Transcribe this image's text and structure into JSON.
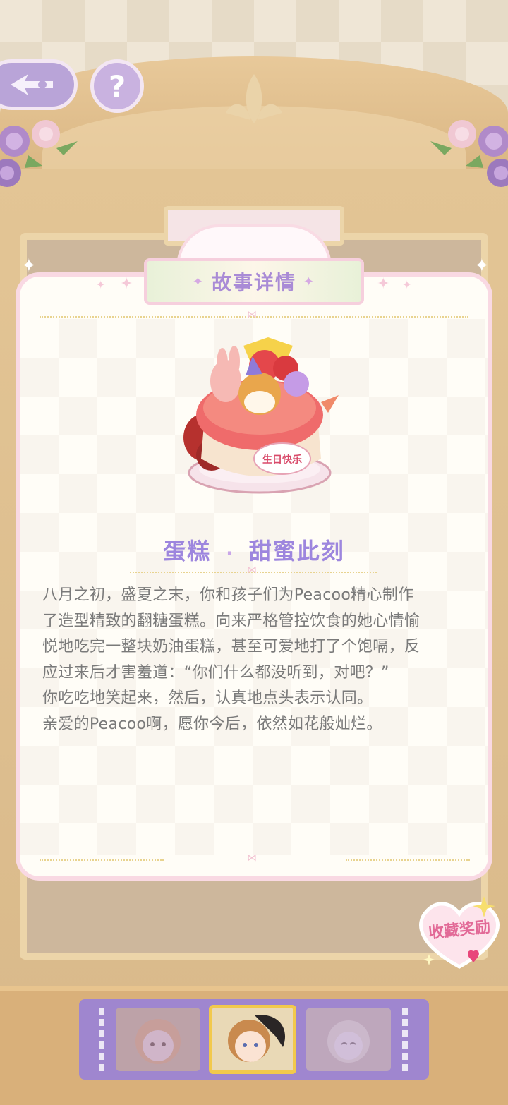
{
  "header": {
    "back_icon": "back-arrow-icon",
    "help_label": "?"
  },
  "dialog": {
    "title": "故事详情",
    "item_name_part1": "蛋糕",
    "item_name_part2": "甜蜜此刻",
    "item_image": "birthday-cake-image",
    "cake_plaque_text": "生日快乐",
    "story_lines": [
      "八月之初，盛夏之末，你和孩子们为Peacoo精心制作",
      "了造型精致的翻糖蛋糕。向来严格管控饮食的她心情愉",
      "悦地吃完一整块奶油蛋糕，甚至可爱地打了个饱嗝，反",
      "应过来后才害羞道：“你们什么都没听到，对吧？”",
      "你吃吃地笑起来，然后，认真地点头表示认同。",
      "亲爱的Peacoo啊，愿你今后，依然如花般灿烂。"
    ]
  },
  "reward": {
    "label": "收藏奖励"
  },
  "selector": {
    "characters": [
      {
        "name": "character-1",
        "selected": false
      },
      {
        "name": "character-2",
        "selected": true
      },
      {
        "name": "character-3",
        "selected": false
      }
    ]
  },
  "colors": {
    "accent_purple": "#9d86de",
    "dialog_border_pink": "#f9d9e3",
    "story_text": "#7a7a7a",
    "reward_pink": "#e26a97"
  }
}
